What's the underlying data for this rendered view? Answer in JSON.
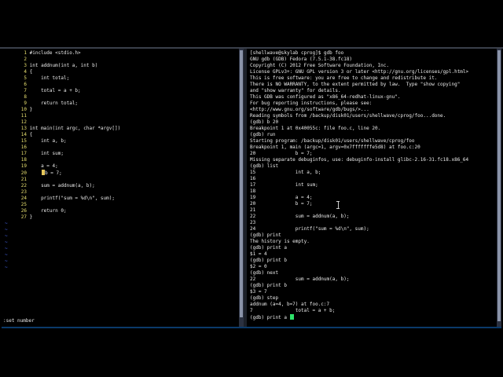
{
  "vim": {
    "lines": [
      {
        "n": "1",
        "text": "#include <stdio.h>"
      },
      {
        "n": "2",
        "text": ""
      },
      {
        "n": "3",
        "text": "int addnum(int a, int b)"
      },
      {
        "n": "4",
        "text": "{"
      },
      {
        "n": "5",
        "text": "    int total;"
      },
      {
        "n": "6",
        "text": ""
      },
      {
        "n": "7",
        "text": "    total = a + b;"
      },
      {
        "n": "8",
        "text": ""
      },
      {
        "n": "9",
        "text": "    return total;"
      },
      {
        "n": "10",
        "text": "}"
      },
      {
        "n": "11",
        "text": ""
      },
      {
        "n": "12",
        "text": ""
      },
      {
        "n": "13",
        "text": "int main(int argc, char *argv[])"
      },
      {
        "n": "14",
        "text": "{"
      },
      {
        "n": "15",
        "text": "    int a, b;"
      },
      {
        "n": "16",
        "text": ""
      },
      {
        "n": "17",
        "text": "    int sum;"
      },
      {
        "n": "18",
        "text": ""
      },
      {
        "n": "19",
        "text": "    a = 4;"
      },
      {
        "n": "20",
        "text": "b = 7;",
        "cursor": true
      },
      {
        "n": "21",
        "text": ""
      },
      {
        "n": "22",
        "text": "    sum = addnum(a, b);"
      },
      {
        "n": "23",
        "text": ""
      },
      {
        "n": "24",
        "text": "    printf(\"sum = %d\\n\", sum);"
      },
      {
        "n": "25",
        "text": ""
      },
      {
        "n": "26",
        "text": "    return 0;"
      },
      {
        "n": "27",
        "text": "}"
      }
    ],
    "tilde_count": 8,
    "command_line": ":set number"
  },
  "gdb": {
    "lines": [
      "[shellwave@skylab cprog]$ gdb foo",
      "GNU gdb (GDB) Fedora (7.5.1-38.fc18)",
      "Copyright (C) 2012 Free Software Foundation, Inc.",
      "License GPLv3+: GNU GPL version 3 or later <http://gnu.org/licenses/gpl.html>",
      "This is free software: you are free to change and redistribute it.",
      "There is NO WARRANTY, to the extent permitted by law.  Type \"show copying\"",
      "and \"show warranty\" for details.",
      "This GDB was configured as \"x86_64-redhat-linux-gnu\".",
      "For bug reporting instructions, please see:",
      "<http://www.gnu.org/software/gdb/bugs/>...",
      "Reading symbols from /backup/disk01/users/shellwave/cprog/foo...done.",
      "(gdb) b 20",
      "Breakpoint 1 at 0x40055c: file foo.c, line 20.",
      "(gdb) run",
      "Starting program: /backup/disk01/users/shellwave/cprog/foo",
      "",
      "Breakpoint 1, main (argc=1, argv=0x7fffffffe5d8) at foo.c:20",
      "20              b = 7;",
      "Missing separate debuginfos, use: debuginfo-install glibc-2.16-31.fc18.x86_64",
      "(gdb) list",
      "15              int a, b;",
      "16",
      "17              int sum;",
      "18",
      "19              a = 4;",
      "20              b = 7;",
      "21",
      "22              sum = addnum(a, b);",
      "23",
      "24              printf(\"sum = %d\\n\", sum);",
      "(gdb) print",
      "The history is empty.",
      "(gdb) print a",
      "$1 = 4",
      "(gdb) print b",
      "$2 = 0",
      "(gdb) next",
      "22              sum = addnum(a, b);",
      "(gdb) print b",
      "$3 = 7",
      "(gdb) step",
      "addnum (a=4, b=7) at foo.c:7",
      "7               total = a + b;"
    ],
    "prompt_line": "(gdb) print a"
  }
}
